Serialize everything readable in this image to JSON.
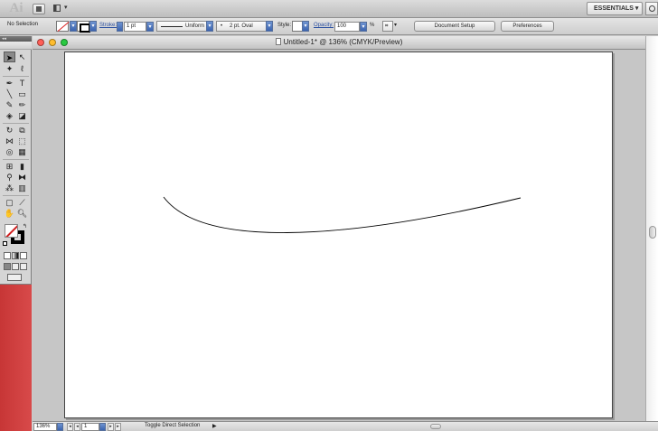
{
  "app": {
    "logo": "Ai",
    "workspace": "ESSENTIALS ▾"
  },
  "control_bar": {
    "selection": "No Selection",
    "stroke_label": "Stroke:",
    "stroke_weight": "1 pt",
    "variable_width_profile": "Uniform",
    "brush": "2 pt. Oval",
    "style_label": "Style:",
    "opacity_label": "Opacity:",
    "opacity_value": "100",
    "opacity_unit": "%",
    "document_setup": "Document Setup",
    "preferences": "Preferences"
  },
  "document": {
    "title": "Untitled-1* @ 136% (CMYK/Preview)"
  },
  "status_bar": {
    "zoom": "136%",
    "artboard_number": "1",
    "status": "Toggle Direct Selection"
  },
  "colors": {
    "close": "#ff5f57",
    "minimize": "#ffbd2e",
    "zoom": "#28c940",
    "fill_none_slash": "#d01e1e",
    "link": "#2a4fa0"
  }
}
